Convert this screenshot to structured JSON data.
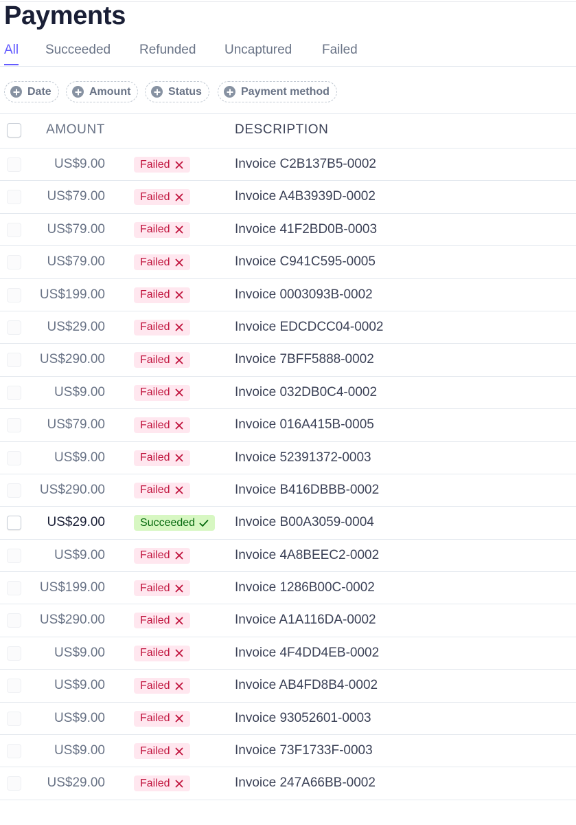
{
  "page": {
    "title": "Payments"
  },
  "tabs": [
    {
      "label": "All",
      "active": true
    },
    {
      "label": "Succeeded",
      "active": false
    },
    {
      "label": "Refunded",
      "active": false
    },
    {
      "label": "Uncaptured",
      "active": false
    },
    {
      "label": "Failed",
      "active": false
    }
  ],
  "filters": [
    {
      "label": "Date",
      "icon": "plus-circle-icon"
    },
    {
      "label": "Amount",
      "icon": "plus-circle-icon"
    },
    {
      "label": "Status",
      "icon": "plus-circle-icon"
    },
    {
      "label": "Payment method",
      "icon": "plus-circle-icon"
    }
  ],
  "table": {
    "columns": {
      "amount": "AMOUNT",
      "description": "DESCRIPTION"
    },
    "rows": [
      {
        "amount": "US$9.00",
        "status": "Failed",
        "description": "Invoice C2B137B5-0002"
      },
      {
        "amount": "US$79.00",
        "status": "Failed",
        "description": "Invoice A4B3939D-0002"
      },
      {
        "amount": "US$79.00",
        "status": "Failed",
        "description": "Invoice 41F2BD0B-0003"
      },
      {
        "amount": "US$79.00",
        "status": "Failed",
        "description": "Invoice C941C595-0005"
      },
      {
        "amount": "US$199.00",
        "status": "Failed",
        "description": "Invoice 0003093B-0002"
      },
      {
        "amount": "US$29.00",
        "status": "Failed",
        "description": "Invoice EDCDCC04-0002"
      },
      {
        "amount": "US$290.00",
        "status": "Failed",
        "description": "Invoice 7BFF5888-0002"
      },
      {
        "amount": "US$9.00",
        "status": "Failed",
        "description": "Invoice 032DB0C4-0002"
      },
      {
        "amount": "US$79.00",
        "status": "Failed",
        "description": "Invoice 016A415B-0005"
      },
      {
        "amount": "US$9.00",
        "status": "Failed",
        "description": "Invoice 52391372-0003"
      },
      {
        "amount": "US$290.00",
        "status": "Failed",
        "description": "Invoice B416DBBB-0002"
      },
      {
        "amount": "US$29.00",
        "status": "Succeeded",
        "description": "Invoice B00A3059-0004"
      },
      {
        "amount": "US$9.00",
        "status": "Failed",
        "description": "Invoice 4A8BEEC2-0002"
      },
      {
        "amount": "US$199.00",
        "status": "Failed",
        "description": "Invoice 1286B00C-0002"
      },
      {
        "amount": "US$290.00",
        "status": "Failed",
        "description": "Invoice A1A116DA-0002"
      },
      {
        "amount": "US$9.00",
        "status": "Failed",
        "description": "Invoice 4F4DD4EB-0002"
      },
      {
        "amount": "US$9.00",
        "status": "Failed",
        "description": "Invoice AB4FD8B4-0002"
      },
      {
        "amount": "US$9.00",
        "status": "Failed",
        "description": "Invoice 93052601-0003"
      },
      {
        "amount": "US$9.00",
        "status": "Failed",
        "description": "Invoice 73F1733F-0003"
      },
      {
        "amount": "US$29.00",
        "status": "Failed",
        "description": "Invoice 247A66BB-0002"
      }
    ]
  },
  "colors": {
    "accent": "#635bff",
    "failed_bg": "#ffe7ef",
    "failed_text": "#c0123c",
    "succeeded_bg": "#d7f7c2",
    "succeeded_text": "#05690d"
  }
}
